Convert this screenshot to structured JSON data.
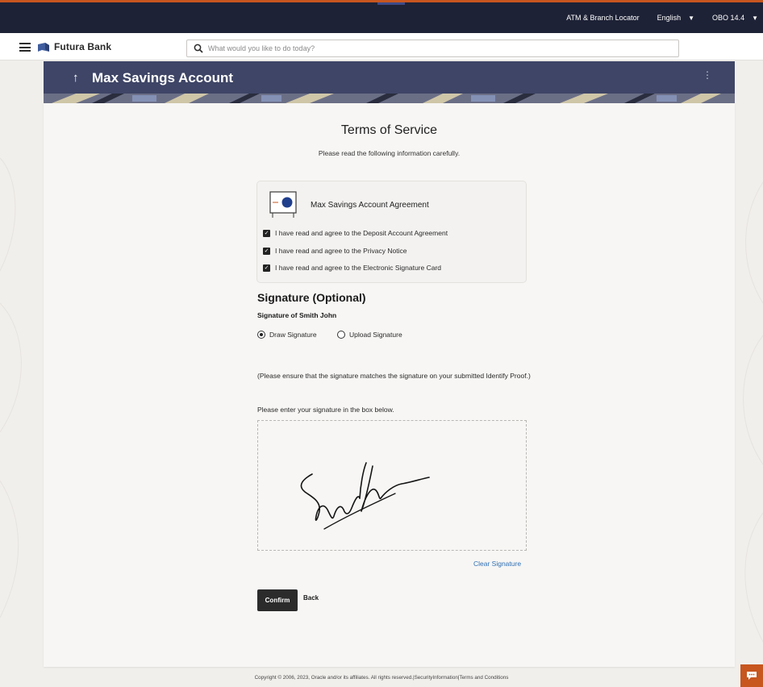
{
  "top_bar": {
    "locator": "ATM & Branch Locator",
    "language": "English",
    "user": "OBO 14.4"
  },
  "nav": {
    "brand": "Futura Bank",
    "search_placeholder": "What would you like to do today?"
  },
  "header": {
    "title": "Max Savings Account"
  },
  "terms": {
    "title": "Terms of Service",
    "subtitle": "Please read the following information carefully.",
    "agreement_title": "Max Savings Account Agreement",
    "checkboxes": [
      {
        "label": "I have read and agree to the Deposit Account Agreement",
        "checked": true
      },
      {
        "label": "I have read and agree to the Privacy Notice",
        "checked": true
      },
      {
        "label": "I have read and agree to the Electronic Signature Card",
        "checked": true
      }
    ]
  },
  "signature": {
    "heading": "Signature (Optional)",
    "sub": "Signature of Smith John",
    "options": [
      {
        "label": "Draw Signature",
        "selected": true
      },
      {
        "label": "Upload Signature",
        "selected": false
      }
    ],
    "note": "(Please ensure that the signature matches the signature on your submitted Identify Proof.)",
    "instruction": "Please enter your signature in the box below.",
    "clear_label": "Clear Signature"
  },
  "actions": {
    "confirm": "Confirm",
    "back": "Back"
  },
  "footer": {
    "text": "Copyright © 2006, 2023, Oracle and/or its affiliates. All rights reserved.|SecurityInformation|Terms and Conditions"
  },
  "colors": {
    "header_bg": "#3e4566",
    "utility_bg": "#1e2236",
    "accent": "#c7561f",
    "link": "#2f6fb3"
  },
  "icons": [
    "hamburger-icon",
    "bank-logo-icon",
    "search-icon",
    "back-arrow-icon",
    "kebab-menu-icon",
    "document-icon",
    "checkbox-checked-icon",
    "chat-icon"
  ]
}
